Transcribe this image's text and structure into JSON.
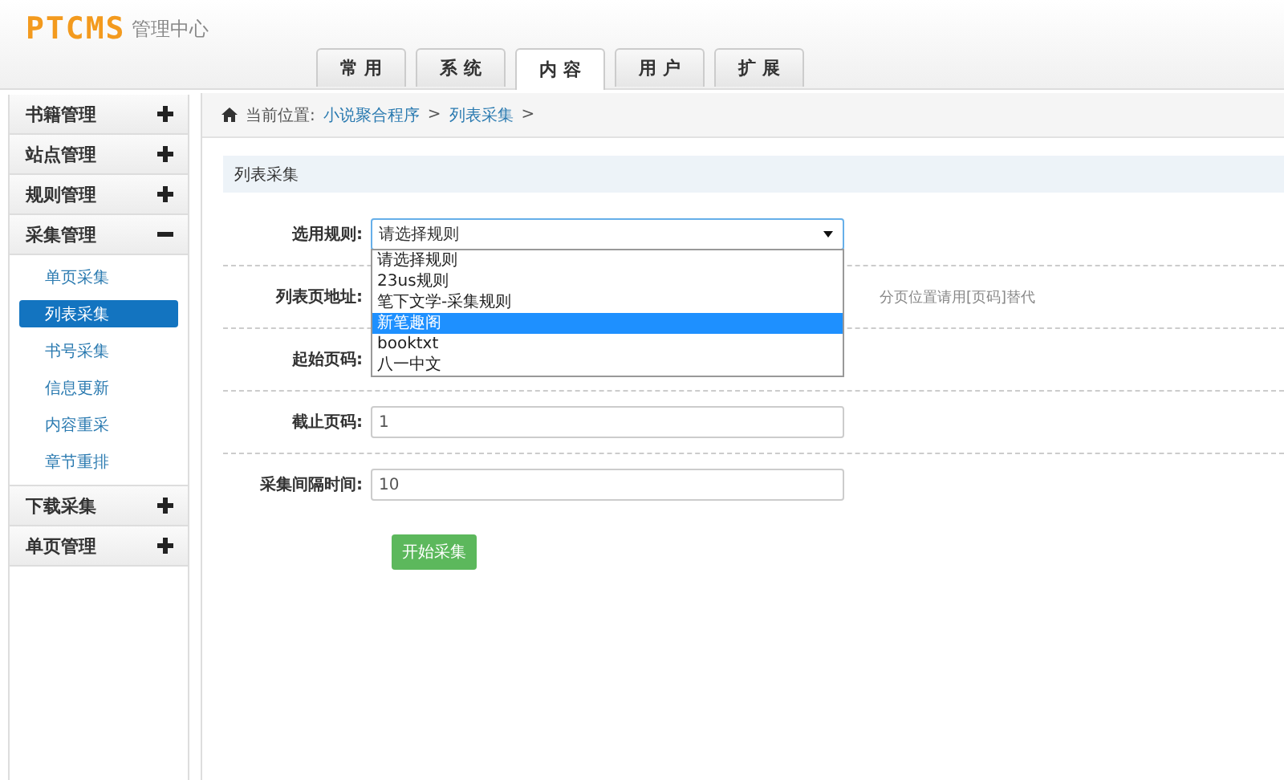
{
  "header": {
    "logo": "PTCMS",
    "subtitle": "管理中心",
    "tabs": [
      {
        "label": "常 用",
        "selected": false
      },
      {
        "label": "系 统",
        "selected": false
      },
      {
        "label": "内 容",
        "selected": true
      },
      {
        "label": "用 户",
        "selected": false
      },
      {
        "label": "扩 展",
        "selected": false
      }
    ]
  },
  "sidebar": {
    "groups": [
      {
        "label": "书籍管理",
        "expanded": false
      },
      {
        "label": "站点管理",
        "expanded": false
      },
      {
        "label": "规则管理",
        "expanded": false
      },
      {
        "label": "采集管理",
        "expanded": true,
        "children": [
          {
            "label": "单页采集",
            "selected": false
          },
          {
            "label": "列表采集",
            "selected": true
          },
          {
            "label": "书号采集",
            "selected": false
          },
          {
            "label": "信息更新",
            "selected": false
          },
          {
            "label": "内容重采",
            "selected": false
          },
          {
            "label": "章节重排",
            "selected": false
          }
        ]
      },
      {
        "label": "下载采集",
        "expanded": false
      },
      {
        "label": "单页管理",
        "expanded": false
      }
    ]
  },
  "breadcrumb": {
    "prefix": "当前位置:",
    "links": [
      "小说聚合程序",
      "列表采集"
    ],
    "separator": ">"
  },
  "panel": {
    "title": "列表采集",
    "rows": [
      {
        "kind": "select",
        "label": "选用规则:",
        "value": "请选择规则",
        "expanded": true,
        "options": [
          {
            "label": "请选择规则",
            "highlighted": false
          },
          {
            "label": "23us规则",
            "highlighted": false
          },
          {
            "label": "笔下文学-采集规则",
            "highlighted": false
          },
          {
            "label": "新笔趣阁",
            "highlighted": true
          },
          {
            "label": "booktxt",
            "highlighted": false
          },
          {
            "label": "八一中文",
            "highlighted": false
          }
        ]
      },
      {
        "kind": "covered",
        "label": "列表页地址:",
        "hint": "分页位置请用[页码]替代"
      },
      {
        "kind": "covered",
        "label": "起始页码:"
      },
      {
        "kind": "text",
        "label": "截止页码:",
        "value": "1"
      },
      {
        "kind": "text",
        "label": "采集间隔时间:",
        "value": "10"
      }
    ],
    "submit": "开始采集"
  }
}
